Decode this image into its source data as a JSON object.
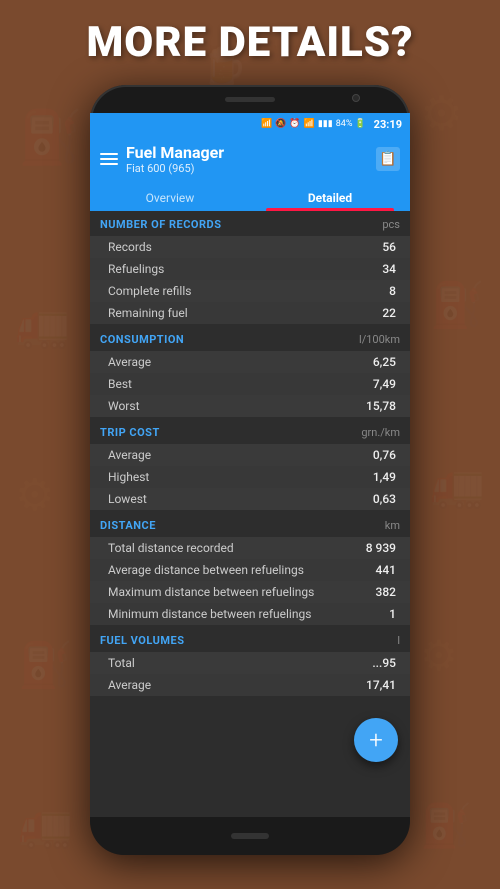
{
  "page": {
    "title": "MORE DETAILS?",
    "background_color": "#7a4a2e"
  },
  "status_bar": {
    "time": "23:19",
    "battery_percent": "84%",
    "icons": [
      "bluetooth",
      "notifications-off",
      "alarm",
      "wifi",
      "signal"
    ]
  },
  "app_bar": {
    "title": "Fuel Manager",
    "subtitle": "Fiat 600 (965)",
    "menu_icon": "hamburger",
    "action_icon": "note"
  },
  "tabs": [
    {
      "label": "Overview",
      "active": false
    },
    {
      "label": "Detailed",
      "active": true
    }
  ],
  "sections": [
    {
      "id": "records",
      "title": "NUMBER OF RECORDS",
      "unit": "pcs",
      "rows": [
        {
          "label": "Records",
          "value": "56"
        },
        {
          "label": "Refuelings",
          "value": "34"
        },
        {
          "label": "Complete refills",
          "value": "8"
        },
        {
          "label": "Remaining fuel",
          "value": "22"
        }
      ]
    },
    {
      "id": "consumption",
      "title": "CONSUMPTION",
      "unit": "l/100km",
      "rows": [
        {
          "label": "Average",
          "value": "6,25"
        },
        {
          "label": "Best",
          "value": "7,49"
        },
        {
          "label": "Worst",
          "value": "15,78"
        }
      ]
    },
    {
      "id": "trip_cost",
      "title": "TRIP COST",
      "unit": "grn./km",
      "rows": [
        {
          "label": "Average",
          "value": "0,76"
        },
        {
          "label": "Highest",
          "value": "1,49"
        },
        {
          "label": "Lowest",
          "value": "0,63"
        }
      ]
    },
    {
      "id": "distance",
      "title": "DISTANCE",
      "unit": "km",
      "rows": [
        {
          "label": "Total distance recorded",
          "value": "8 939"
        },
        {
          "label": "Average distance between refuelings",
          "value": "441"
        },
        {
          "label": "Maximum distance between refuelings",
          "value": "382"
        },
        {
          "label": "Minimum distance between refuelings",
          "value": "1"
        }
      ]
    },
    {
      "id": "fuel_volumes",
      "title": "FUEL VOLUMES",
      "unit": "l",
      "rows": [
        {
          "label": "Total",
          "value": "...95"
        },
        {
          "label": "Average",
          "value": "17,41"
        }
      ]
    }
  ],
  "fab": {
    "label": "+"
  }
}
